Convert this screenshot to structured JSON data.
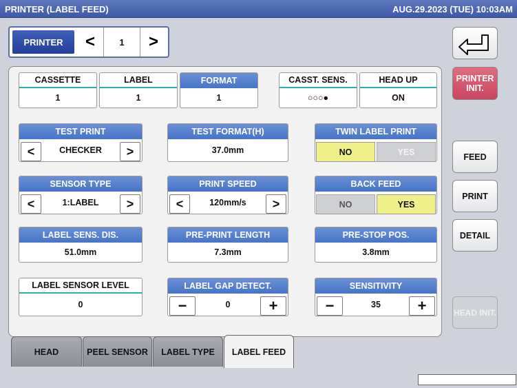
{
  "title": "PRINTER (LABEL FEED)",
  "datetime": "AUG.29.2023 (TUE) 10:03AM",
  "printer_selector": {
    "label": "PRINTER",
    "prev": "<",
    "value": "1",
    "next": ">"
  },
  "status_row": [
    {
      "label": "CASSETTE",
      "value": "1"
    },
    {
      "label": "LABEL",
      "value": "1"
    },
    {
      "label": "FORMAT",
      "value": "1"
    },
    {
      "label": "CASST. SENS.",
      "value": "○○○●"
    },
    {
      "label": "HEAD UP",
      "value": "ON"
    }
  ],
  "test_print": {
    "label": "TEST PRINT",
    "value": "CHECKER",
    "prev": "<",
    "next": ">"
  },
  "test_format": {
    "label": "TEST FORMAT(H)",
    "value": "37.0mm"
  },
  "twin_label_print": {
    "label": "TWIN LABEL PRINT",
    "no": "NO",
    "yes": "YES",
    "selected": "NO"
  },
  "sensor_type": {
    "label": "SENSOR TYPE",
    "value": "1:LABEL",
    "prev": "<",
    "next": ">"
  },
  "print_speed": {
    "label": "PRINT SPEED",
    "value": "120mm/s",
    "prev": "<",
    "next": ">"
  },
  "back_feed": {
    "label": "BACK FEED",
    "no": "NO",
    "yes": "YES",
    "selected": "YES"
  },
  "label_sens_dis": {
    "label": "LABEL SENS. DIS.",
    "value": "51.0mm"
  },
  "pre_print_length": {
    "label": "PRE-PRINT LENGTH",
    "value": "7.3mm"
  },
  "pre_stop_pos": {
    "label": "PRE-STOP POS.",
    "value": "3.8mm"
  },
  "label_sensor_level": {
    "label": "LABEL SENSOR LEVEL",
    "value": "0"
  },
  "label_gap_detect": {
    "label": "LABEL GAP DETECT.",
    "value": "0",
    "minus": "−",
    "plus": "+"
  },
  "sensitivity": {
    "label": "SENSITIVITY",
    "value": "35",
    "minus": "−",
    "plus": "+"
  },
  "tabs": [
    {
      "label": "HEAD"
    },
    {
      "label": "PEEL SENSOR"
    },
    {
      "label": "LABEL TYPE"
    },
    {
      "label": "LABEL FEED"
    }
  ],
  "side_buttons": {
    "printer_init": "PRINTER INIT.",
    "feed": "FEED",
    "print": "PRINT",
    "detail": "DETAIL",
    "head_init": "HEAD INIT."
  },
  "colors": {
    "title_bar": "#4a66b2",
    "header_blue": "#4f7cc9",
    "accent_teal": "#27b0a8",
    "selected_yellow": "#f0f08a",
    "printer_init_red": "#d4566a"
  }
}
